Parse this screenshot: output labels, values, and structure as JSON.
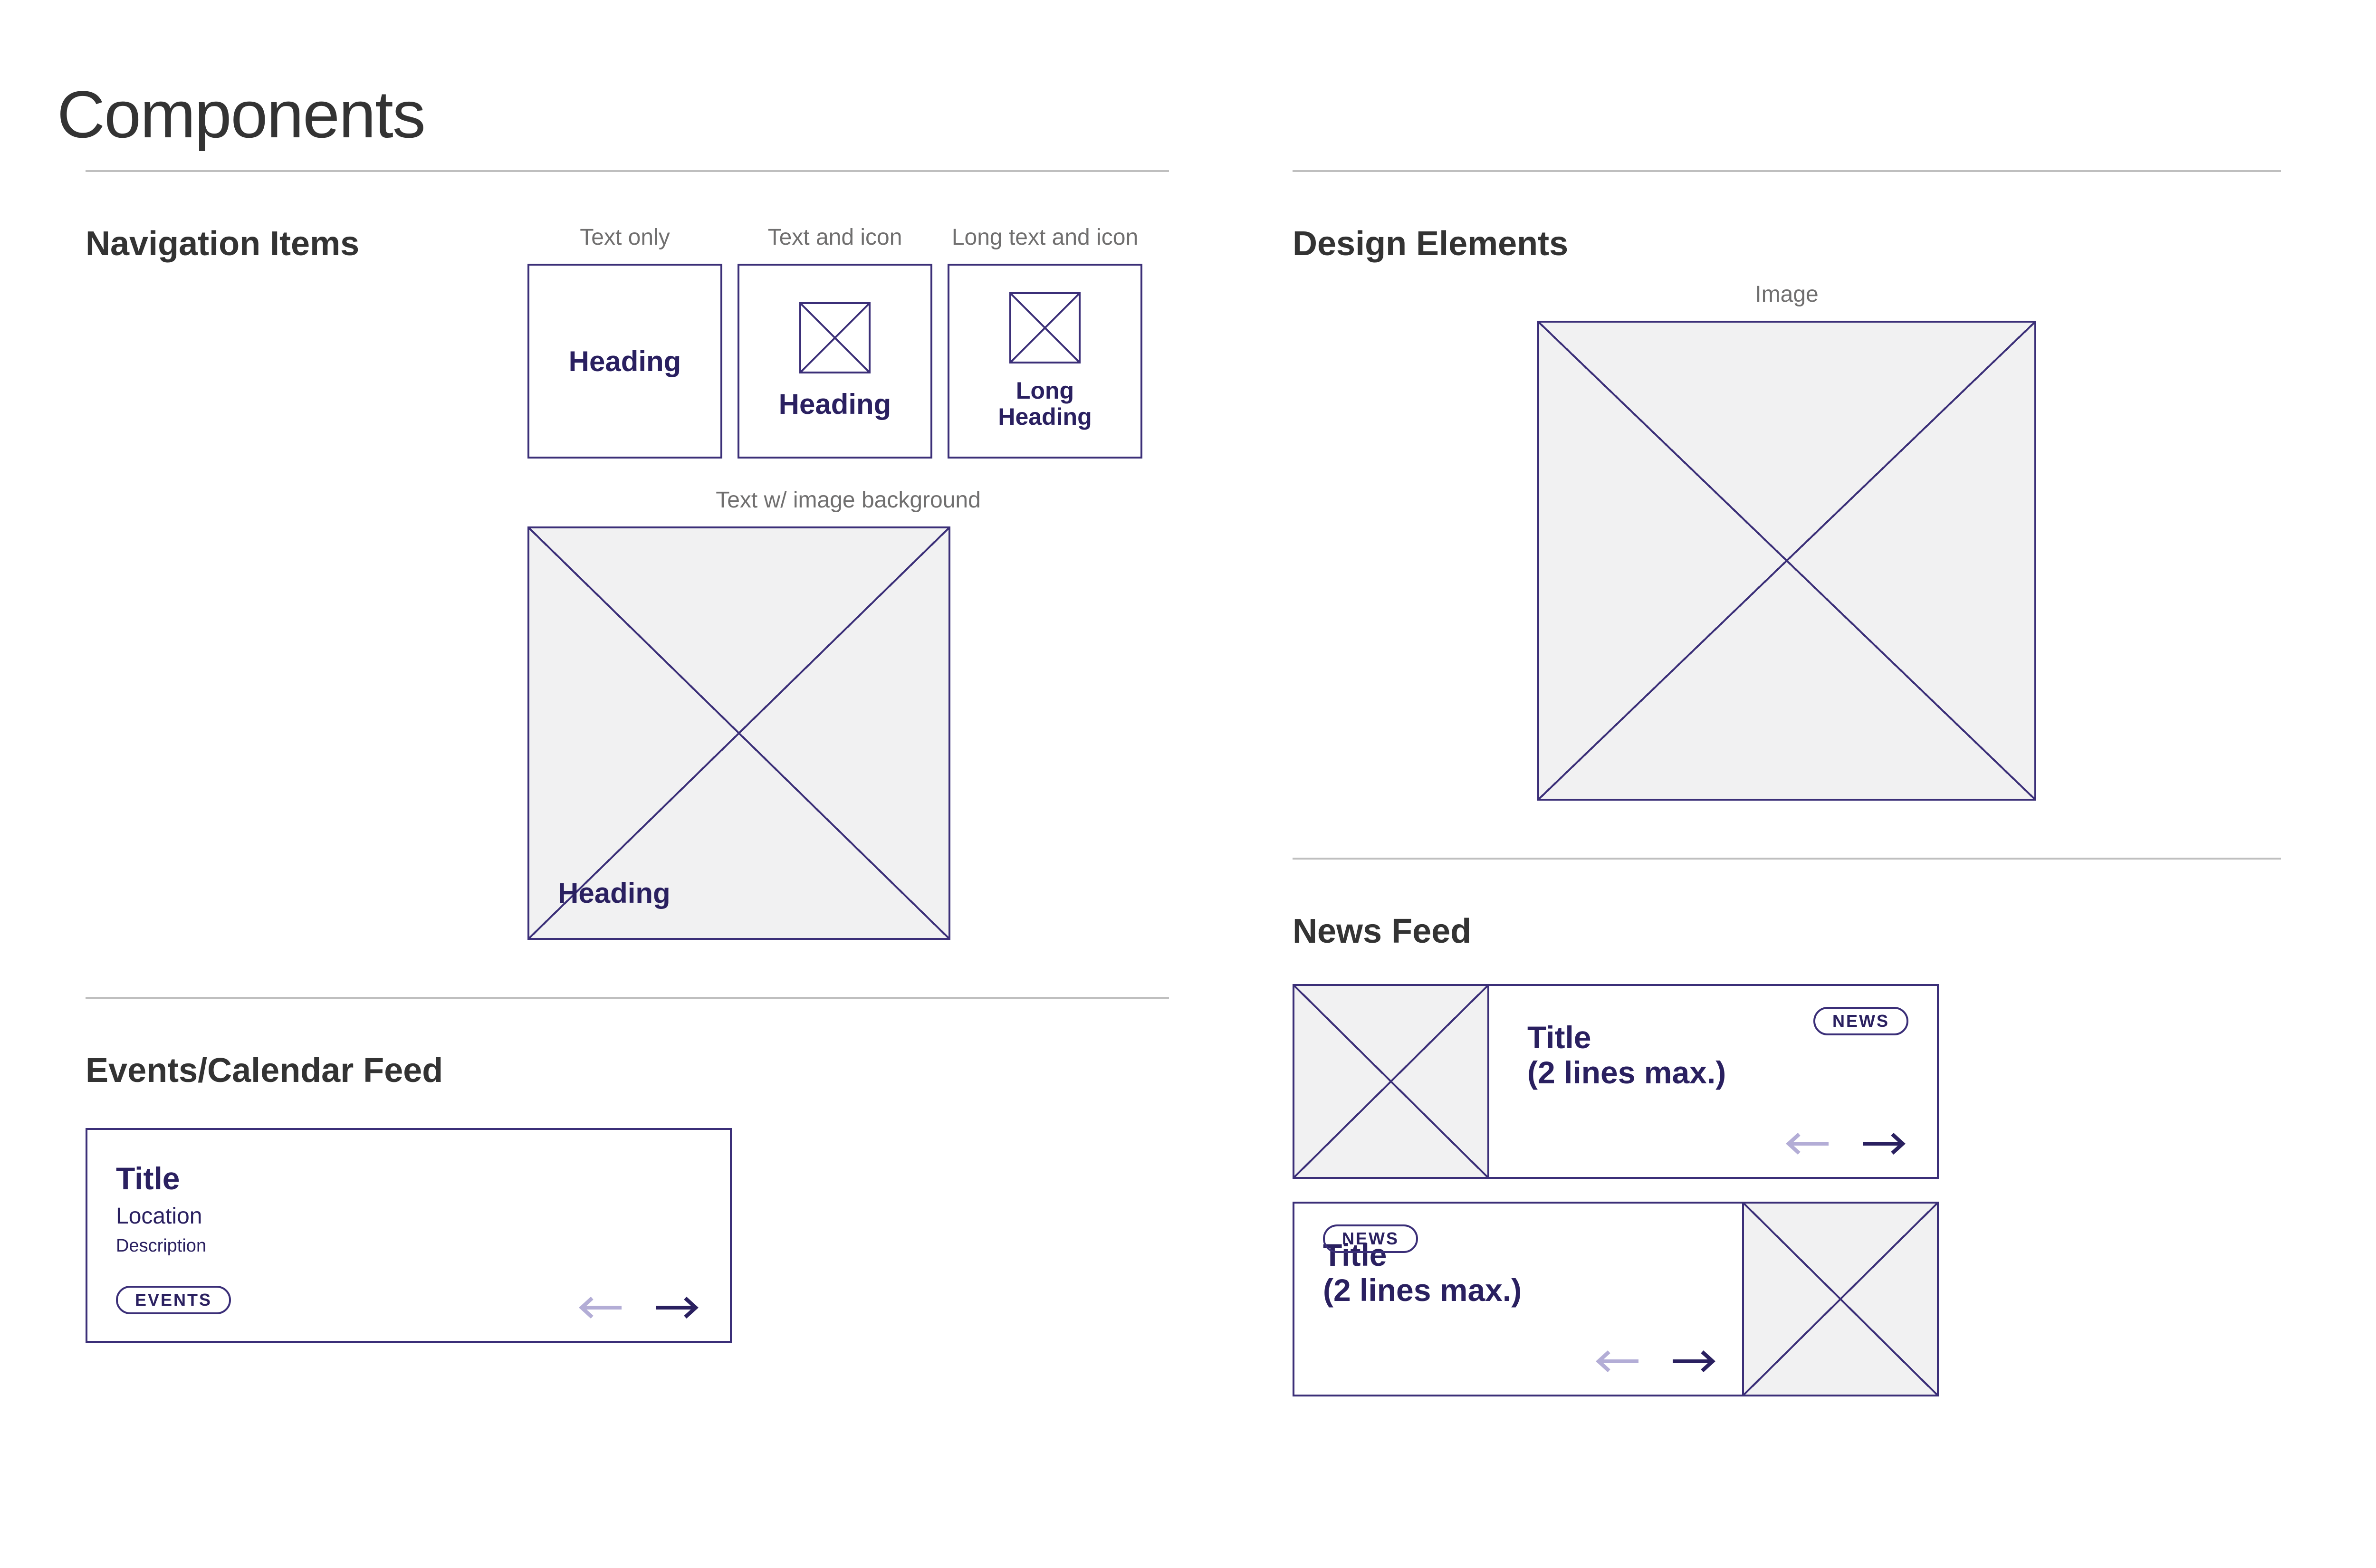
{
  "page_title": "Components",
  "navigation": {
    "section_title": "Navigation Items",
    "variants": {
      "text_only": {
        "label": "Text only",
        "heading": "Heading"
      },
      "text_icon": {
        "label": "Text and icon",
        "heading": "Heading"
      },
      "long_text_icon": {
        "label": "Long text and icon",
        "heading_line1": "Long",
        "heading_line2": "Heading"
      },
      "image_bg": {
        "label": "Text w/ image background",
        "heading": "Heading"
      }
    }
  },
  "events": {
    "section_title": "Events/Calendar Feed",
    "card": {
      "title": "Title",
      "location": "Location",
      "description": "Description",
      "chip": "EVENTS"
    }
  },
  "design_elements": {
    "section_title": "Design Elements",
    "image_label": "Image"
  },
  "news": {
    "section_title": "News Feed",
    "cards": [
      {
        "chip": "NEWS",
        "title_line1": "Title",
        "title_line2": "(2 lines max.)",
        "layout": "thumb-left"
      },
      {
        "chip": "NEWS",
        "title_line1": "Title",
        "title_line2": "(2 lines max.)",
        "layout": "thumb-right"
      }
    ]
  }
}
